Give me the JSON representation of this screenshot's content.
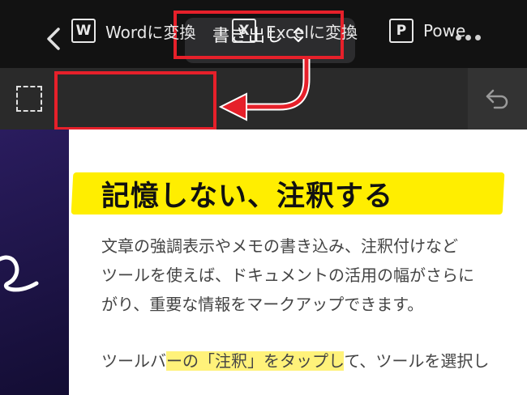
{
  "topbar": {
    "title": "書き出し",
    "back_icon": "chevron-left-icon",
    "title_icon": "chevron-up-down-icon",
    "more_icon": "more-horizontal-icon"
  },
  "toolbar": {
    "items": [
      {
        "icon_letter": "W",
        "label": "Wordに変換"
      },
      {
        "icon_letter": "X",
        "label": "Excelに変換"
      },
      {
        "icon_letter": "P",
        "label": "Powe"
      }
    ],
    "select_icon": "dashed-selection-icon",
    "undo_icon": "undo-icon"
  },
  "document": {
    "heading": "記憶しない、注釈する",
    "paragraph_lines": [
      "文章の強調表示やメモの書き込み、注釈付けなど",
      "ツールを使えば、ドキュメントの活用の幅がさらに",
      "がり、重要な情報をマークアップできます。"
    ],
    "instruction_pre": "ツールバ",
    "instruction_hl": "ーの「注釈」をタップし",
    "instruction_post": "て、ツールを選択し"
  },
  "colors": {
    "annotation_red": "#e6202a",
    "highlight_yellow": "#ffee00",
    "topbar_bg": "#121212",
    "toolbar_bg": "#2a2a2a"
  }
}
